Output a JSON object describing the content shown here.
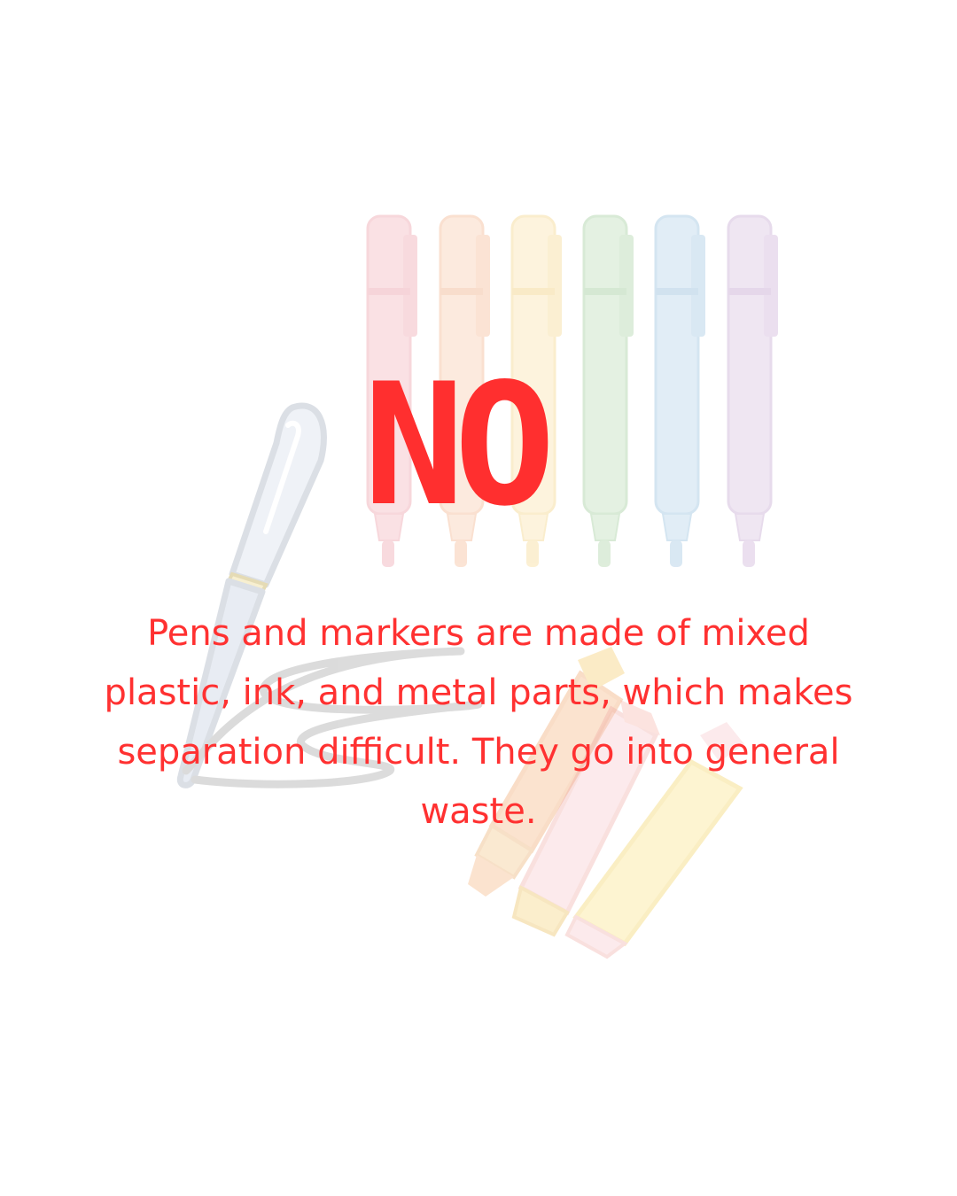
{
  "headline": "NO",
  "body_text": "Pens and markers are made of mixed plastic, ink, and metal parts, which makes separation difficult. They go into general waste.",
  "colors": {
    "background": "#FFFFFF",
    "headline": "#FF2F2F",
    "body_text": "#FF3131",
    "marker_red": "#F7C9CF",
    "marker_orange": "#FBD9C4",
    "marker_yellow": "#FCEBC2",
    "marker_green": "#CFE6CC",
    "marker_blue": "#C9DFEF",
    "marker_purple": "#E3D3E8",
    "pen": "#D3DBE6"
  },
  "icons": [
    "marker-icon",
    "pen-icon",
    "highlighter-icon"
  ]
}
